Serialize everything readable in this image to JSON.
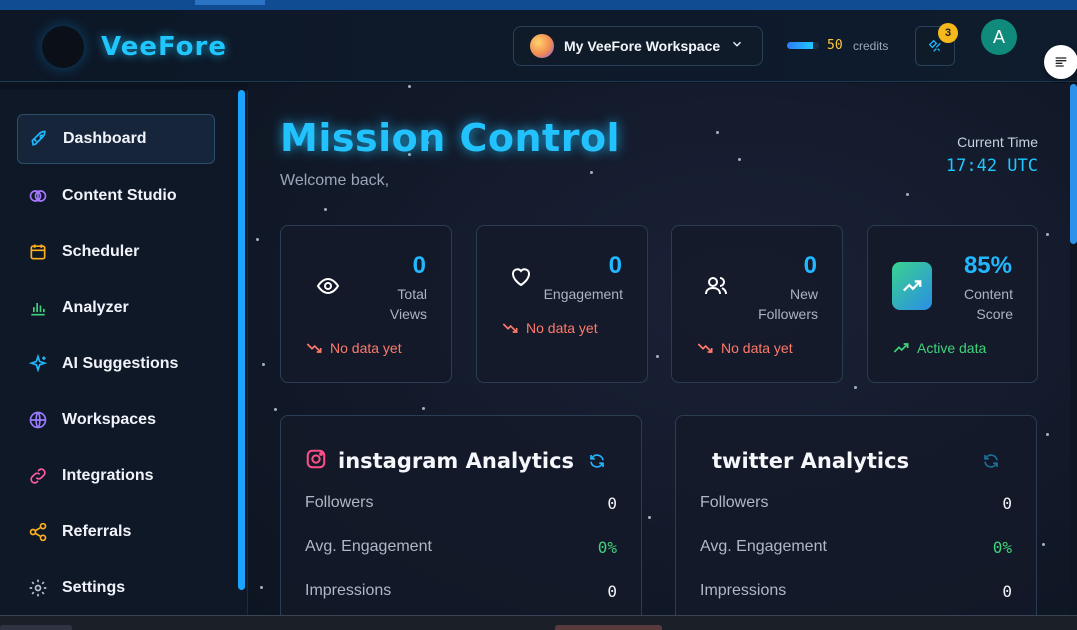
{
  "app": {
    "logo_text": "VeeFore"
  },
  "header": {
    "workspace_name": "My VeeFore Workspace",
    "credits_value": "50",
    "credits_label": "credits",
    "notification_count": "3",
    "user_initial": "A"
  },
  "sidebar": {
    "items": [
      {
        "label": "Dashboard",
        "icon": "rocket-icon",
        "active": true
      },
      {
        "label": "Content Studio",
        "icon": "brain-icon"
      },
      {
        "label": "Scheduler",
        "icon": "calendar-icon"
      },
      {
        "label": "Analyzer",
        "icon": "bar-chart-icon"
      },
      {
        "label": "AI Suggestions",
        "icon": "sparkles-icon"
      },
      {
        "label": "Workspaces",
        "icon": "globe-icon"
      },
      {
        "label": "Integrations",
        "icon": "link-icon"
      },
      {
        "label": "Referrals",
        "icon": "share-icon"
      },
      {
        "label": "Settings",
        "icon": "gear-icon"
      }
    ]
  },
  "main": {
    "title": "Mission Control",
    "welcome": "Welcome back,",
    "time_label": "Current Time",
    "time_value": "17:42 UTC",
    "stats": [
      {
        "value": "0",
        "label_line1": "Total",
        "label_line2": "Views",
        "trend": "No data yet",
        "icon": "eye-icon"
      },
      {
        "value": "0",
        "label_line1": "Engagement",
        "label_line2": "",
        "trend": "No data yet",
        "icon": "heart-icon"
      },
      {
        "value": "0",
        "label_line1": "New",
        "label_line2": "Followers",
        "trend": "No data yet",
        "icon": "users-icon"
      },
      {
        "value": "85%",
        "label_line1": "Content",
        "label_line2": "Score",
        "trend": "Active data",
        "icon": "trending-up-icon"
      }
    ],
    "panels": [
      {
        "title": "instagram Analytics",
        "rows": [
          {
            "label": "Followers",
            "value": "0"
          },
          {
            "label": "Avg. Engagement",
            "value": "0%"
          },
          {
            "label": "Impressions",
            "value": "0"
          }
        ]
      },
      {
        "title": "twitter Analytics",
        "rows": [
          {
            "label": "Followers",
            "value": "0"
          },
          {
            "label": "Avg. Engagement",
            "value": "0%"
          },
          {
            "label": "Impressions",
            "value": "0"
          }
        ]
      }
    ]
  },
  "colors": {
    "accent": "#20c7ff",
    "negative": "#ff7a6a",
    "positive": "#3fd47c",
    "badge": "#f5b91c"
  }
}
